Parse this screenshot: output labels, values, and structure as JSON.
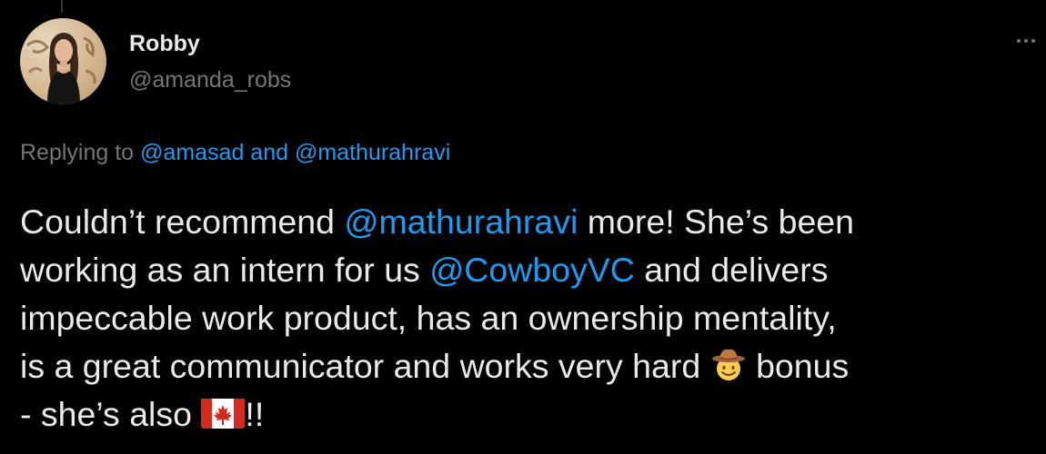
{
  "author": {
    "name": "Robby",
    "handle": "@amanda_robs"
  },
  "reply": {
    "prefix": "Replying to ",
    "mention1": "@amasad",
    "conjunction": " and ",
    "mention2": "@mathurahravi"
  },
  "tweet": {
    "line1_a": "Couldn’t recommend ",
    "line1_mention": "@mathurahravi",
    "line1_b": " more! She’s been",
    "line2_a": "working as an intern for us ",
    "line2_mention": "@CowboyVC",
    "line2_b": " and delivers",
    "line3": "impeccable work product, has an ownership mentality,",
    "line4_a": "is a great communicator and works very hard ",
    "line4_b": " bonus",
    "line5_a": "- she’s also ",
    "line5_b": "!!"
  },
  "icons": {
    "more": "more-options-icon",
    "cowboy": "cowboy-hat-face-emoji",
    "flag": "canada-flag-emoji"
  },
  "colors": {
    "background": "#000000",
    "text": "#e7e9ea",
    "secondary": "#71767b",
    "link": "#1d9bf0"
  }
}
